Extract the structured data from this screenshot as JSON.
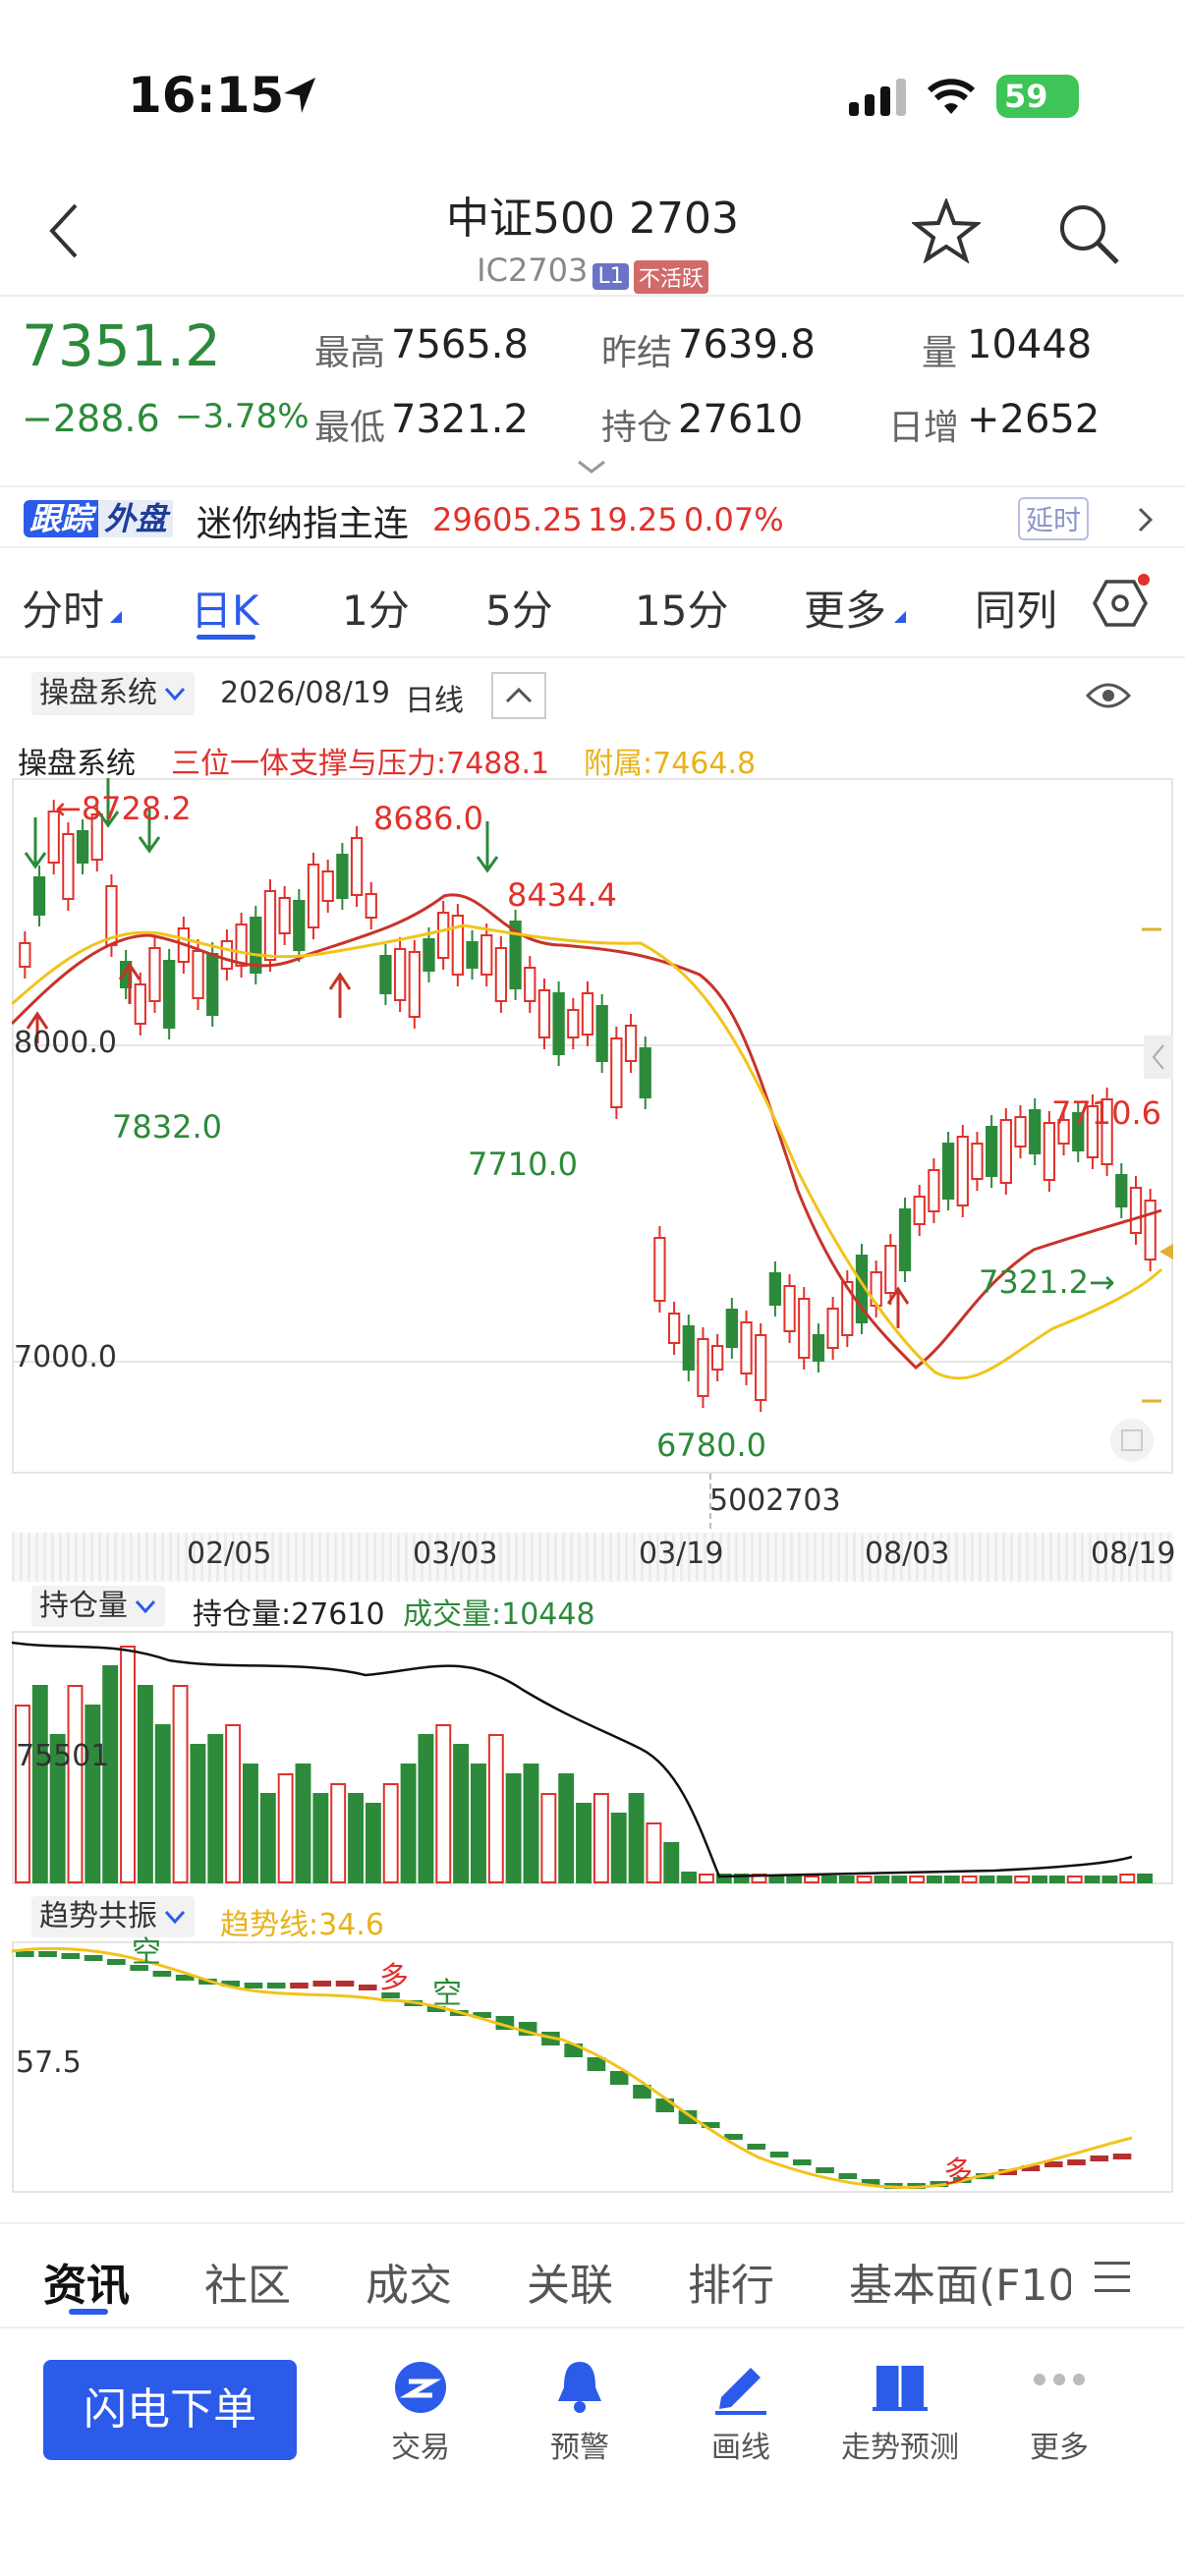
{
  "status": {
    "time": "16:15",
    "battery": "59"
  },
  "header": {
    "title": "中证500 2703",
    "code": "IC2703",
    "level_tag": "L1",
    "inactive_tag": "不活跃"
  },
  "quote": {
    "price": "7351.2",
    "change": "−288.6",
    "change_pct": "−3.78%",
    "high_label": "最高",
    "high": "7565.8",
    "low_label": "最低",
    "low": "7321.2",
    "prev_label": "昨结",
    "prev": "7639.8",
    "oi_label": "持仓",
    "oi": "27610",
    "vol_label": "量",
    "vol": "10448",
    "daily_inc_label": "日增",
    "daily_inc": "+2652"
  },
  "ticker": {
    "tag1": "跟踪",
    "tag2": "外盘",
    "name": "迷你纳指主连",
    "price": "29605.25",
    "change": "19.25",
    "pct": "0.07%",
    "delay": "延时"
  },
  "period_tabs": [
    "分时",
    "日K",
    "1分",
    "5分",
    "15分",
    "更多",
    "同列"
  ],
  "chart_toolbar": {
    "system": "操盘系统",
    "date": "2026/08/19",
    "period": "日线"
  },
  "indicator_line": {
    "name": "操盘系统",
    "main": "三位一体支撑与压力:7488.1",
    "sub": "附属:7464.8"
  },
  "kline_labels": {
    "y_8000": "8000.0",
    "y_7000": "7000.0",
    "hi_left": "←8728.2",
    "hi_mid": "8686.0",
    "hi_b": "8434.4",
    "lo_a": "7832.0",
    "lo_b": "7710.0",
    "lo_c": "6780.0",
    "hi_right": "7710.6",
    "lo_right": "7321.2→",
    "watermark": "5002703"
  },
  "x_axis": [
    "02/05",
    "03/03",
    "03/19",
    "08/03",
    "08/19"
  ],
  "oi_panel": {
    "name": "持仓量",
    "oi_text": "持仓量:27610",
    "vol_text": "成交量:10448",
    "y_label": "75501"
  },
  "trend_panel": {
    "name": "趋势共振",
    "line_text": "趋势线:34.6",
    "y_label": "57.5",
    "m1": "空",
    "m2": "多",
    "m3": "空",
    "m4": "多"
  },
  "bottom_tabs": [
    "资讯",
    "社区",
    "成交",
    "关联",
    "排行",
    "基本面(F10"
  ],
  "nav": {
    "order_button": "闪电下单",
    "items": [
      "交易",
      "预警",
      "画线",
      "走势预测",
      "更多"
    ]
  },
  "colors": {
    "up": "#e0312b",
    "down": "#2c8a3a",
    "accent": "#2b5be8",
    "ma_red": "#c8332a",
    "ma_yellow": "#f2c31b"
  },
  "chart_data": {
    "type": "candlestick",
    "y_ticks": [
      8000.0,
      7000.0
    ],
    "annotations": {
      "high_left": 8728.2,
      "high_mid": 8686.0,
      "high_b": 8434.4,
      "low_a": 7832.0,
      "low_b": 7710.0,
      "low_c": 6780.0,
      "high_right": 7710.6,
      "low_right": 7321.2
    }
  }
}
